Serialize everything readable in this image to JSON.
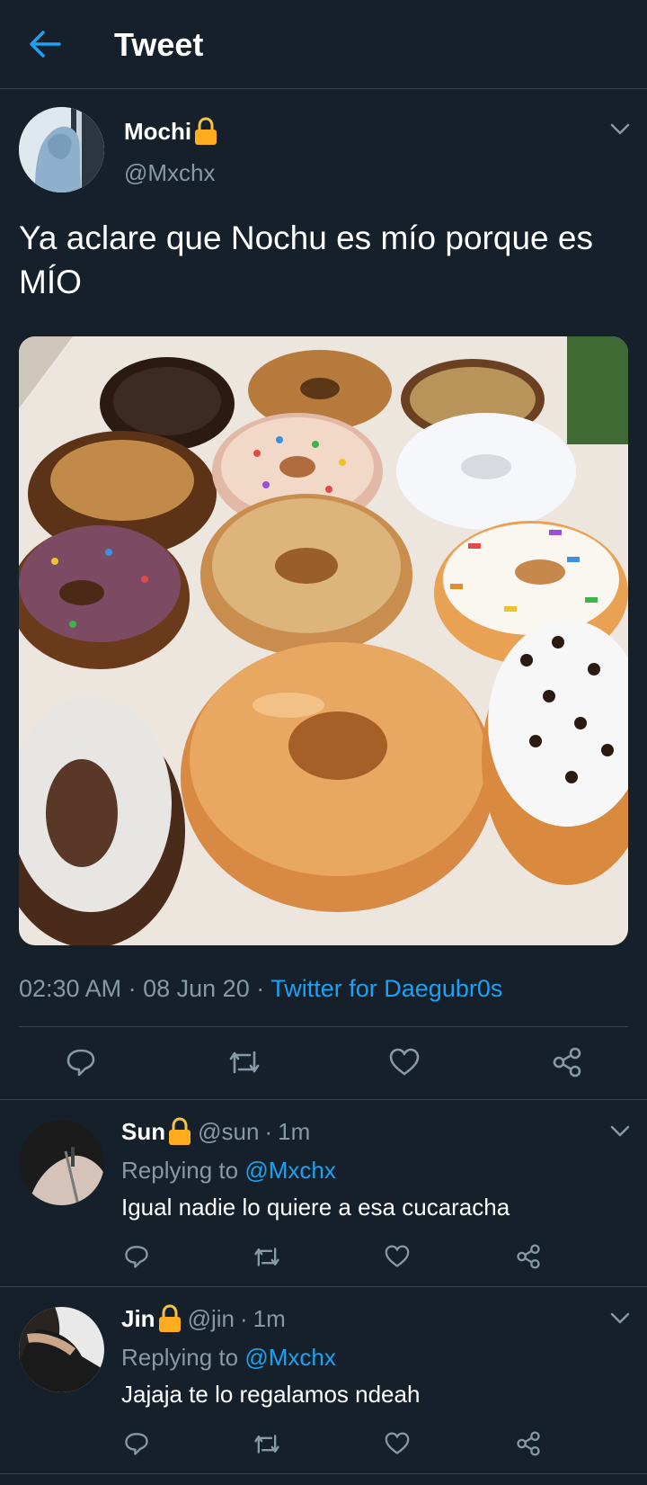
{
  "header": {
    "title": "Tweet"
  },
  "tweet": {
    "author": {
      "name": "Mochi",
      "handle": "@Mxchx"
    },
    "text": "Ya aclare que Nochu es mío porque es MÍO",
    "time": "02:30 AM",
    "date": "08 Jun 20",
    "separator": "·",
    "source": "Twitter for Daegubr0s"
  },
  "replies": [
    {
      "name": "Sun",
      "handle": "@sun",
      "separator": "·",
      "time": "1m",
      "replying_prefix": "Replying to ",
      "replying_to": "@Mxchx",
      "text": "Igual nadie lo quiere a esa cucaracha"
    },
    {
      "name": "Jin",
      "handle": "@jin",
      "separator": "·",
      "time": "1m",
      "replying_prefix": "Replying to ",
      "replying_to": "@Mxchx",
      "text": "Jajaja te lo regalamos ndeah"
    }
  ],
  "icons": {
    "back": "arrow-left-icon",
    "lock": "lock-icon",
    "menu": "chevron-down-icon",
    "reply": "reply-icon",
    "retweet": "retweet-icon",
    "like": "heart-icon",
    "share": "share-icon"
  },
  "colors": {
    "background": "#15202b",
    "accent": "#1da1f2",
    "secondary_text": "#8899a6",
    "divider": "#38444d",
    "lock": "#ffad1f"
  }
}
